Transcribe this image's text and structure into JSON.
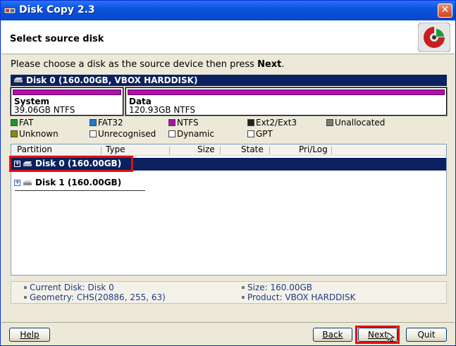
{
  "window": {
    "title": "Disk Copy 2.3"
  },
  "header": {
    "title": "Select source disk"
  },
  "instruction": {
    "text": "Please choose a disk as the source device then press ",
    "emphasis": "Next",
    "tail": "."
  },
  "disk_banner": {
    "label": "Disk 0 (160.00GB, VBOX HARDDISK)"
  },
  "partitions": [
    {
      "name": "System",
      "info": "39.06GB NTFS",
      "color": "#b10db1"
    },
    {
      "name": "Data",
      "info": "120.93GB NTFS",
      "color": "#b10db1"
    }
  ],
  "legend": [
    {
      "label": "FAT",
      "color": "#1a9a2a"
    },
    {
      "label": "FAT32",
      "color": "#1e78d8"
    },
    {
      "label": "NTFS",
      "color": "#b10db1"
    },
    {
      "label": "Ext2/Ext3",
      "color": "#222222"
    },
    {
      "label": "Unallocated",
      "color": "#7a7a7a"
    },
    {
      "label": "Unknown",
      "color": "#8a8a10"
    },
    {
      "label": "Unrecognised",
      "color": "#ffffff"
    },
    {
      "label": "Dynamic",
      "color": "#ffffff"
    },
    {
      "label": "GPT",
      "color": "#ffffff"
    }
  ],
  "columns": [
    "Partition",
    "Type",
    "Size",
    "State",
    "Pri/Log"
  ],
  "disks": [
    {
      "label": "Disk 0 (160.00GB)",
      "selected": true
    },
    {
      "label": "Disk 1 (160.00GB)",
      "selected": false
    }
  ],
  "info": {
    "current_disk": "Current Disk: Disk 0",
    "geometry": "Geometry: CHS(20886, 255, 63)",
    "size": "Size: 160.00GB",
    "product": "Product: VBOX HARDDISK"
  },
  "buttons": {
    "help": "Help",
    "back": "Back",
    "next": "Next",
    "quit": "Quit"
  },
  "accent": {
    "selection": "#0b2160",
    "highlight": "#e01010"
  }
}
